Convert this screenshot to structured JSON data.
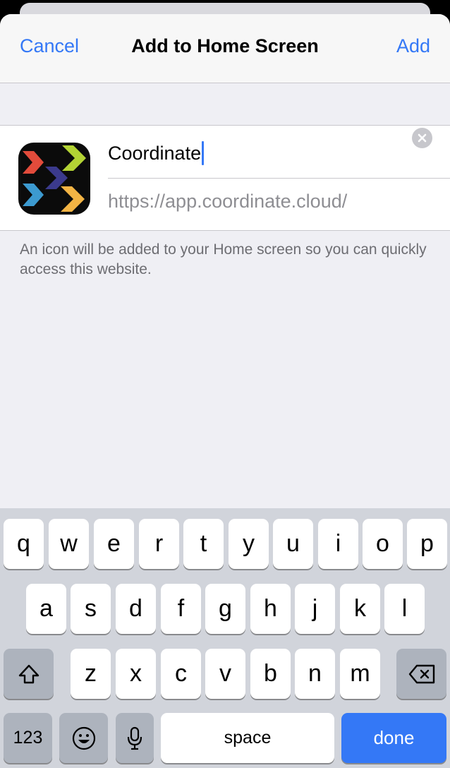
{
  "nav": {
    "cancel_label": "Cancel",
    "title": "Add to Home Screen",
    "add_label": "Add"
  },
  "form": {
    "name_value": "Coordinate",
    "url": "https://app.coordinate.cloud/"
  },
  "hint_text": "An icon will be added to your Home screen so you can quickly access this website.",
  "keyboard": {
    "row1": [
      "q",
      "w",
      "e",
      "r",
      "t",
      "y",
      "u",
      "i",
      "o",
      "p"
    ],
    "row2": [
      "a",
      "s",
      "d",
      "f",
      "g",
      "h",
      "j",
      "k",
      "l"
    ],
    "row3": [
      "z",
      "x",
      "c",
      "v",
      "b",
      "n",
      "m"
    ],
    "numbers_label": "123",
    "space_label": "space",
    "done_label": "done"
  },
  "colors": {
    "accent": "#3478f6",
    "sheet_bg": "#efeff4",
    "keyboard_bg": "#d1d4db"
  },
  "icons": {
    "clear": "clear-text-icon",
    "shift": "shift-icon",
    "backspace": "backspace-icon",
    "emoji": "emoji-icon",
    "mic": "microphone-icon",
    "app": "coordinate-app-icon"
  }
}
